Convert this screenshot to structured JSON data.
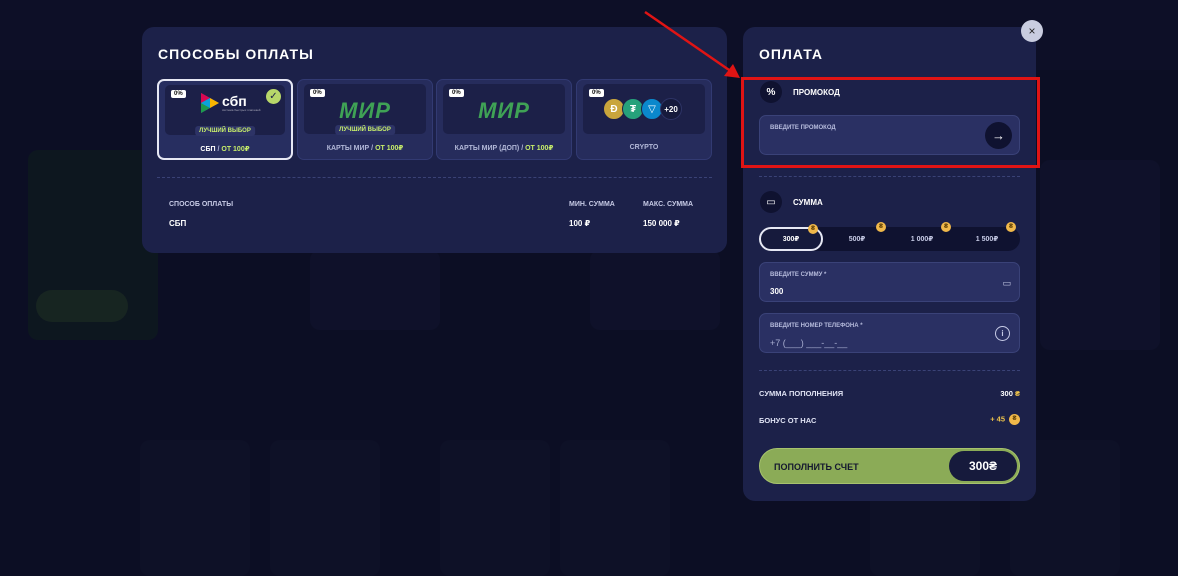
{
  "methods": {
    "title": "СПОСОБЫ ОПЛАТЫ",
    "cards": [
      {
        "fee": "0%",
        "logo": "сбп",
        "logo_sub": "система быстрых платежей",
        "badge": "ЛУЧШИЙ ВЫБОР",
        "name": "СБП",
        "sep": " / ",
        "min": "ОТ 100₽",
        "selected": true
      },
      {
        "fee": "0%",
        "logo": "МИР",
        "badge": "ЛУЧШИЙ ВЫБОР",
        "name": "КАРТЫ МИР",
        "sep": " / ",
        "min": "ОТ 100₽",
        "selected": false
      },
      {
        "fee": "0%",
        "logo": "МИР",
        "badge": "",
        "name": "КАРТЫ МИР (ДОП)",
        "sep": " / ",
        "min": "ОТ 100₽",
        "selected": false
      },
      {
        "fee": "0%",
        "logo": "crypto",
        "more": "+20",
        "name": "CRYPTO",
        "sep": "",
        "min": "",
        "selected": false
      }
    ],
    "info": {
      "method_label": "СПОСОБ ОПЛАТЫ",
      "method_value": "СБП",
      "min_label": "МИН. СУММА",
      "min_value": "100 ₽",
      "max_label": "МАКС. СУММА",
      "max_value": "150 000 ₽"
    }
  },
  "payment": {
    "title": "ОПЛАТА",
    "promo": {
      "title": "ПРОМОКОД",
      "label": "ВВЕДИТЕ ПРОМОКОД",
      "value": ""
    },
    "amount": {
      "title": "СУММА",
      "chips": [
        "300₽",
        "500₽",
        "1 000₽",
        "1 500₽"
      ],
      "active_index": 0,
      "field_label": "ВВЕДИТЕ СУММУ *",
      "field_value": "300"
    },
    "phone": {
      "label": "ВВЕДИТЕ НОМЕР ТЕЛЕФОНА *",
      "placeholder": "+7 (___) ___-__-__"
    },
    "summary": {
      "deposit_label": "СУММА ПОПОЛНЕНИЯ",
      "deposit_value": "300",
      "deposit_currency": "₴",
      "bonus_label": "БОНУС ОТ НАС",
      "bonus_value": "+ 45"
    },
    "submit": {
      "label": "ПОПОЛНИТЬ СЧЕТ",
      "amount": "300₴"
    }
  },
  "close_icon": "×",
  "annotation": {
    "color": "#e01414"
  },
  "accent_colors": {
    "lime": "#c7ee6a",
    "button": "#8bab57",
    "panel": "#1c2149"
  }
}
